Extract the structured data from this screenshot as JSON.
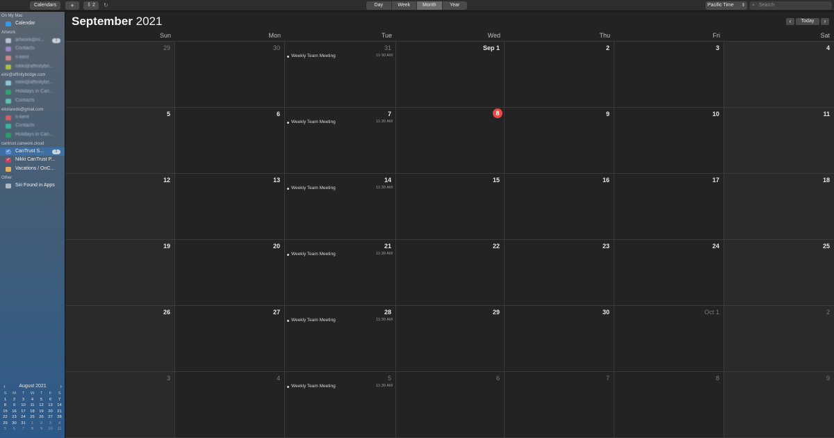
{
  "toolbar": {
    "calendars_label": "Calendars",
    "add_label": "+",
    "inbox_label": "⇩ 2",
    "refresh_glyph": "↻",
    "views": [
      {
        "label": "Day",
        "active": false
      },
      {
        "label": "Week",
        "active": false
      },
      {
        "label": "Month",
        "active": true
      },
      {
        "label": "Year",
        "active": false
      }
    ],
    "timezone": "Pacific Time",
    "timezone_chevron": "⇕",
    "search_placeholder": "Search",
    "search_icon": "⌕"
  },
  "sidebar": {
    "groups": [
      {
        "label": "On My Mac",
        "items": [
          {
            "label": "Calendar",
            "color": "#2f9be6",
            "checked": false,
            "blur": false,
            "badge": ""
          }
        ]
      },
      {
        "label": "Artwork",
        "items": [
          {
            "label": "artwork@ni...",
            "color": "#b7c2ce",
            "checked": false,
            "blur": true,
            "badge": "1"
          },
          {
            "label": "Contacts",
            "color": "#9b86c9",
            "checked": false,
            "blur": true,
            "badge": ""
          },
          {
            "label": "n-kent",
            "color": "#c98686",
            "checked": false,
            "blur": true,
            "badge": ""
          },
          {
            "label": "nikki@affinitybri...",
            "color": "#a7c04a",
            "checked": false,
            "blur": true,
            "badge": ""
          }
        ]
      },
      {
        "label": "elisi@affinitybridge.com",
        "items": [
          {
            "label": "nikki@affinitybri...",
            "color": "#8fc6d6",
            "checked": false,
            "blur": true,
            "badge": ""
          },
          {
            "label": "Holidays in Can...",
            "color": "#2fa36b",
            "checked": false,
            "blur": true,
            "badge": ""
          },
          {
            "label": "Contacts",
            "color": "#5fc0b0",
            "checked": false,
            "blur": true,
            "badge": ""
          }
        ]
      },
      {
        "label": "elisilaredo@gmail.com",
        "items": [
          {
            "label": "n-kent",
            "color": "#d06060",
            "checked": false,
            "blur": true,
            "badge": ""
          },
          {
            "label": "Contacts",
            "color": "#3fb39a",
            "checked": false,
            "blur": true,
            "badge": ""
          },
          {
            "label": "Holidays in Can...",
            "color": "#2f9a6a",
            "checked": false,
            "blur": true,
            "badge": ""
          }
        ]
      },
      {
        "label": "cantrust.canwork.cloud",
        "items": [
          {
            "label": "CanTrust S...",
            "color": "#5b8fd0",
            "checked": true,
            "blur": false,
            "badge": "1",
            "selected": true
          },
          {
            "label": "Nikki CanTrust P...",
            "color": "#d0405a",
            "checked": true,
            "blur": false,
            "badge": ""
          },
          {
            "label": "Vacations / OnC...",
            "color": "#e0b060",
            "checked": false,
            "blur": false,
            "badge": ""
          }
        ]
      },
      {
        "label": "Other",
        "items": [
          {
            "label": "Siri Found in Apps",
            "color": "#aeb8c4",
            "checked": false,
            "blur": false,
            "badge": ""
          }
        ]
      }
    ]
  },
  "mini_calendar": {
    "title": "August 2021",
    "prev": "‹",
    "next": "›",
    "weekdays": [
      "S",
      "M",
      "T",
      "W",
      "T",
      "F",
      "S"
    ],
    "weeks": [
      [
        {
          "d": "1"
        },
        {
          "d": "2"
        },
        {
          "d": "3"
        },
        {
          "d": "4"
        },
        {
          "d": "5"
        },
        {
          "d": "6"
        },
        {
          "d": "7"
        }
      ],
      [
        {
          "d": "8"
        },
        {
          "d": "9"
        },
        {
          "d": "10"
        },
        {
          "d": "11"
        },
        {
          "d": "12"
        },
        {
          "d": "13"
        },
        {
          "d": "14"
        }
      ],
      [
        {
          "d": "15"
        },
        {
          "d": "16"
        },
        {
          "d": "17"
        },
        {
          "d": "18"
        },
        {
          "d": "19"
        },
        {
          "d": "20"
        },
        {
          "d": "21"
        }
      ],
      [
        {
          "d": "22"
        },
        {
          "d": "23"
        },
        {
          "d": "24"
        },
        {
          "d": "25"
        },
        {
          "d": "26"
        },
        {
          "d": "27"
        },
        {
          "d": "28"
        }
      ],
      [
        {
          "d": "29"
        },
        {
          "d": "30"
        },
        {
          "d": "31"
        },
        {
          "d": "1",
          "dim": true
        },
        {
          "d": "2",
          "dim": true
        },
        {
          "d": "3",
          "dim": true
        },
        {
          "d": "4",
          "dim": true
        }
      ],
      [
        {
          "d": "5",
          "dim": true
        },
        {
          "d": "6",
          "dim": true
        },
        {
          "d": "7",
          "dim": true
        },
        {
          "d": "8",
          "dim": true
        },
        {
          "d": "9",
          "dim": true
        },
        {
          "d": "10",
          "dim": true
        },
        {
          "d": "11",
          "dim": true
        }
      ]
    ]
  },
  "main": {
    "title_month": "September",
    "title_year": "2021",
    "nav_prev": "‹",
    "nav_today": "Today",
    "nav_next": "›",
    "weekdays": [
      "Sun",
      "Mon",
      "Tue",
      "Wed",
      "Thu",
      "Fri",
      "Sat"
    ],
    "weeks": [
      [
        {
          "day": "29",
          "dim": true
        },
        {
          "day": "30",
          "dim": true
        },
        {
          "day": "31",
          "dim": true,
          "event": {
            "title": "Weekly Team Meeting",
            "time": "11:30 AM"
          }
        },
        {
          "day": "Sep 1"
        },
        {
          "day": "2"
        },
        {
          "day": "3"
        },
        {
          "day": "4"
        }
      ],
      [
        {
          "day": "5"
        },
        {
          "day": "6"
        },
        {
          "day": "7",
          "event": {
            "title": "Weekly Team Meeting",
            "time": "11:30 AM"
          }
        },
        {
          "day": "8",
          "today": true
        },
        {
          "day": "9"
        },
        {
          "day": "10"
        },
        {
          "day": "11"
        }
      ],
      [
        {
          "day": "12"
        },
        {
          "day": "13"
        },
        {
          "day": "14",
          "event": {
            "title": "Weekly Team Meeting",
            "time": "11:30 AM"
          }
        },
        {
          "day": "15"
        },
        {
          "day": "16"
        },
        {
          "day": "17"
        },
        {
          "day": "18"
        }
      ],
      [
        {
          "day": "19"
        },
        {
          "day": "20"
        },
        {
          "day": "21",
          "event": {
            "title": "Weekly Team Meeting",
            "time": "11:30 AM"
          }
        },
        {
          "day": "22"
        },
        {
          "day": "23"
        },
        {
          "day": "24"
        },
        {
          "day": "25"
        }
      ],
      [
        {
          "day": "26"
        },
        {
          "day": "27"
        },
        {
          "day": "28",
          "event": {
            "title": "Weekly Team Meeting",
            "time": "11:30 AM"
          }
        },
        {
          "day": "29"
        },
        {
          "day": "30"
        },
        {
          "day": "Oct 1",
          "dim": true
        },
        {
          "day": "2",
          "dim": true
        }
      ],
      [
        {
          "day": "3",
          "dim": true
        },
        {
          "day": "4",
          "dim": true
        },
        {
          "day": "5",
          "dim": true,
          "event": {
            "title": "Weekly Team Meeting",
            "time": "11:30 AM"
          }
        },
        {
          "day": "6",
          "dim": true
        },
        {
          "day": "7",
          "dim": true
        },
        {
          "day": "8",
          "dim": true
        },
        {
          "day": "9",
          "dim": true
        }
      ]
    ]
  },
  "colors": {
    "today_accent": "#e64a45",
    "sidebar_selection": "#3f6ea3"
  }
}
